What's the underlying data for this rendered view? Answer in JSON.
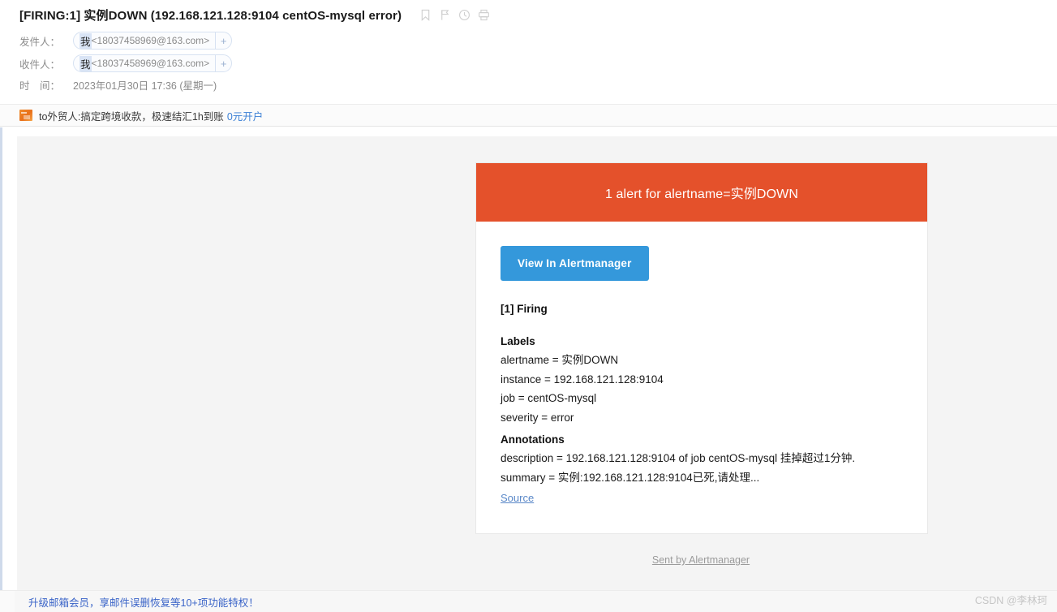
{
  "mail": {
    "subject": "[FIRING:1] 实例DOWN (192.168.121.128:9104 centOS-mysql error)",
    "icons": [
      "bookmark-icon",
      "flag-icon",
      "clock-icon",
      "print-icon"
    ],
    "from_label": "发件人：",
    "to_label": "收件人：",
    "time_label": "时　间：",
    "from_name": "我",
    "from_address": "<18037458969@163.com>",
    "to_name": "我",
    "to_address": "<18037458969@163.com>",
    "add_contact_glyph": "+",
    "timestamp": "2023年01月30日 17:36 (星期一)"
  },
  "ad": {
    "icon": "ad-thumbnail-icon",
    "text": "to外贸人:搞定跨境收款，极速结汇1h到账",
    "link_text": "0元开户"
  },
  "alert": {
    "header_title": "1 alert for alertname=实例DOWN",
    "header_color": "#e4512b",
    "button_label": "View In Alertmanager",
    "button_color": "#3498db",
    "firing_heading": "[1] Firing",
    "labels_heading": "Labels",
    "labels": [
      "alertname = 实例DOWN",
      "instance = 192.168.121.128:9104",
      "job = centOS-mysql",
      "severity = error"
    ],
    "annotations_heading": "Annotations",
    "annotations": [
      "description = 192.168.121.128:9104 of job centOS-mysql 挂掉超过1分钟.",
      "summary = 实例:192.168.121.128:9104已死,请处理..."
    ],
    "source_link": "Source",
    "footer_link": "Sent by Alertmanager"
  },
  "footer": {
    "promo_text": "升级邮箱会员，享邮件误删恢复等10+项功能特权！",
    "watermark": "CSDN @李林珂"
  }
}
